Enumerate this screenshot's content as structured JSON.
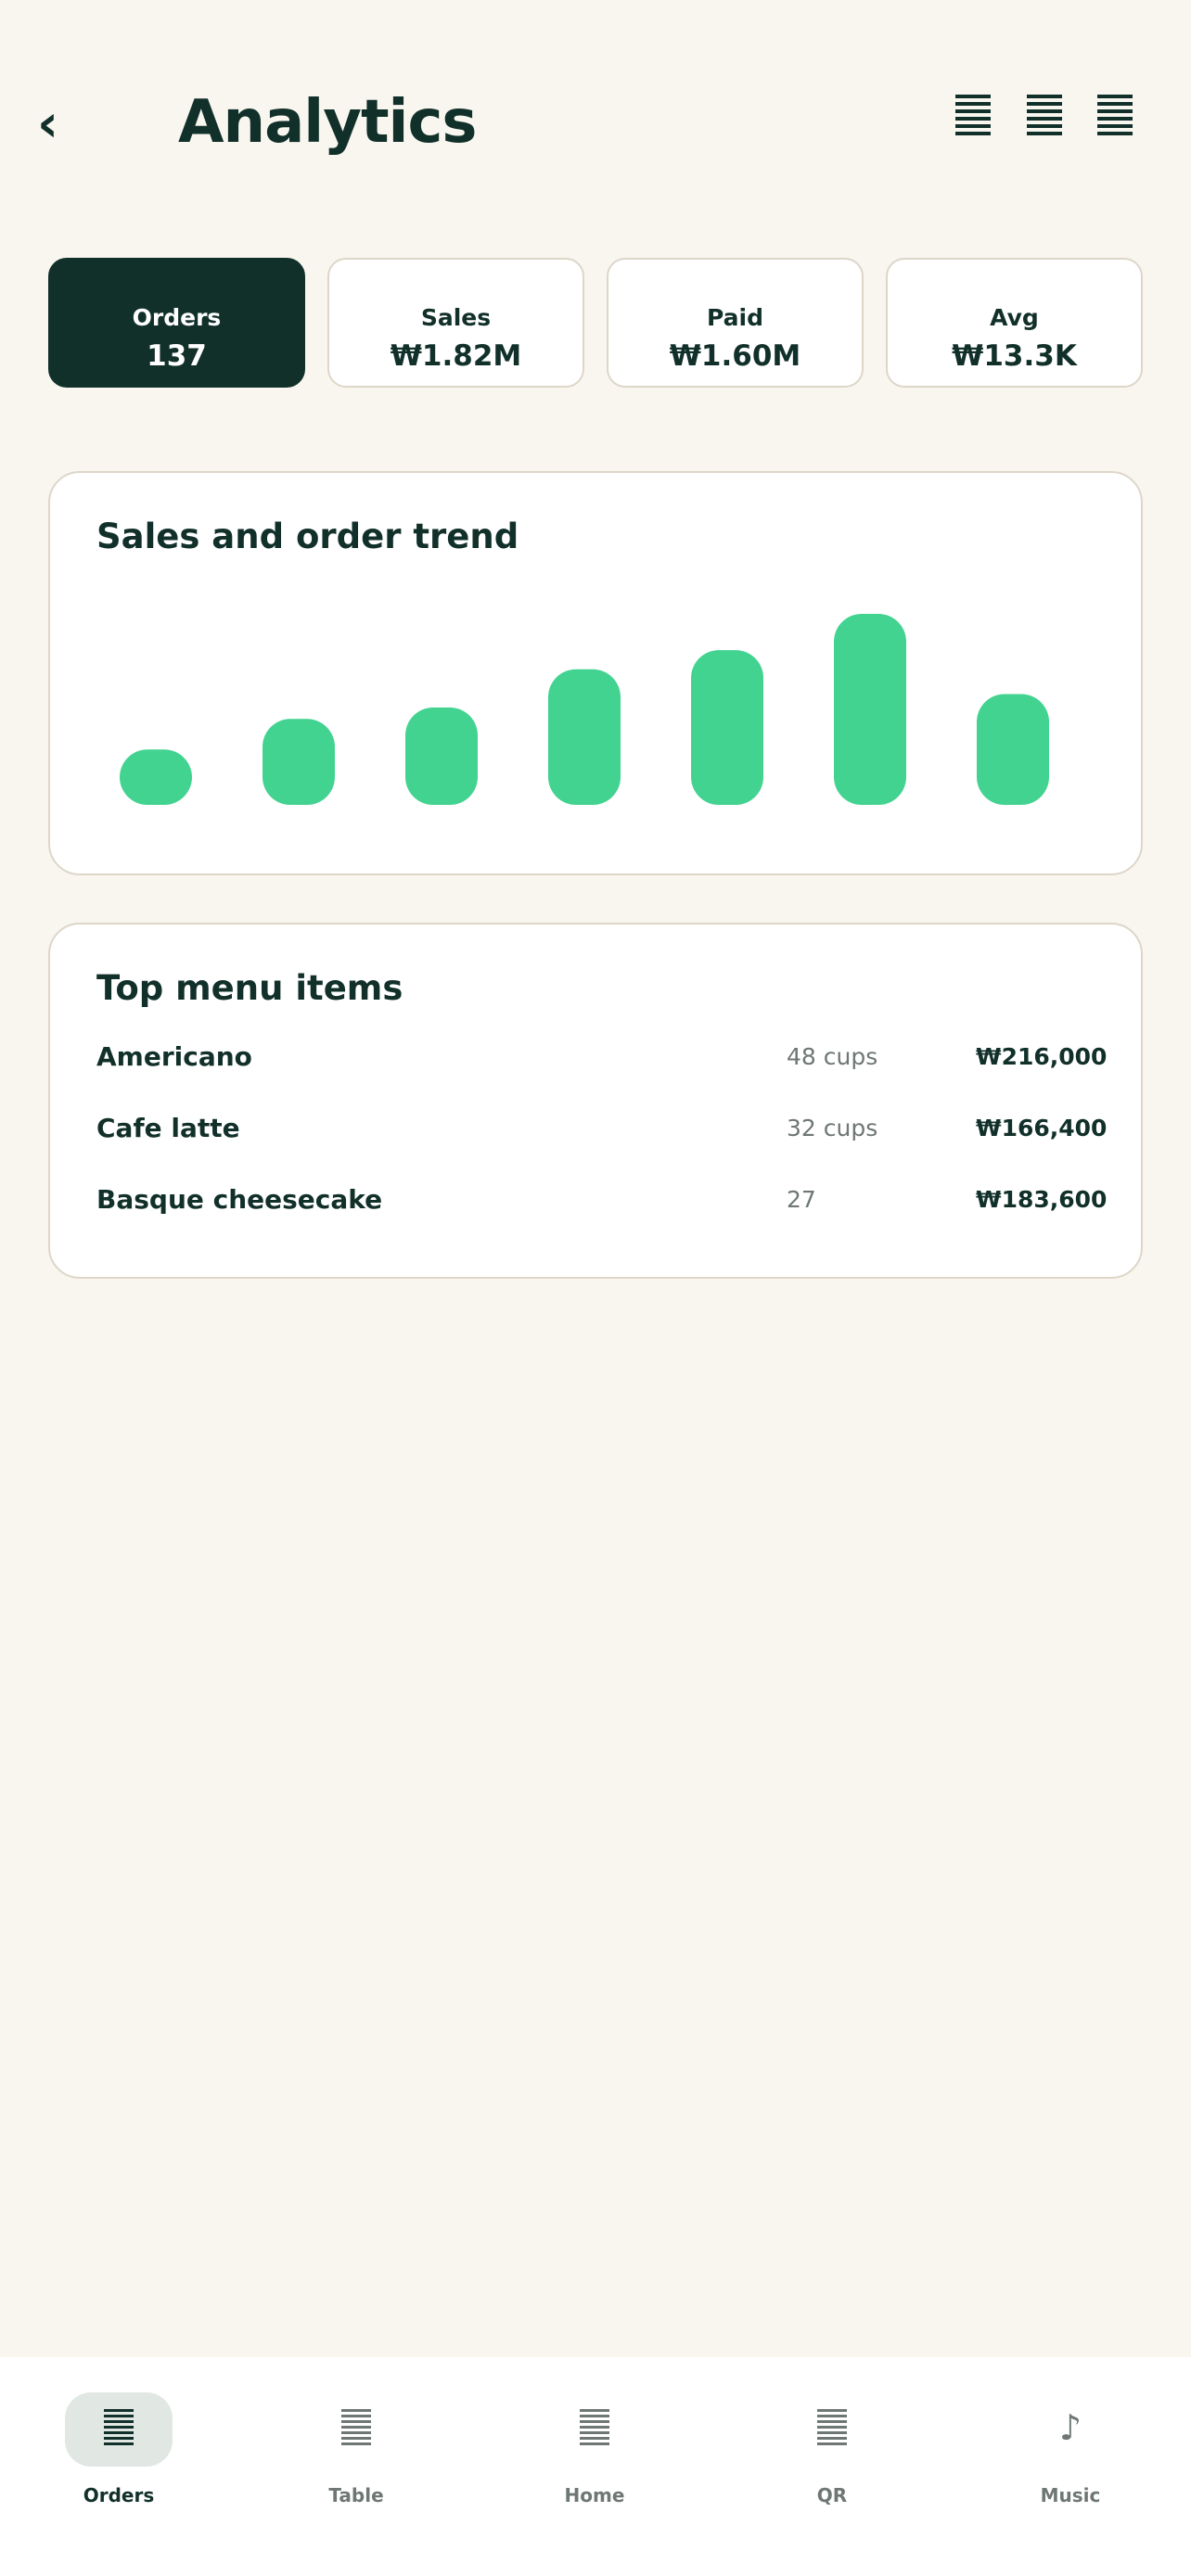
{
  "header": {
    "back_glyph": "‹",
    "title": "Analytics",
    "actions": [
      "list-icon",
      "list-icon",
      "list-icon"
    ]
  },
  "kpis": [
    {
      "label": "Orders",
      "value": "137",
      "active": true
    },
    {
      "label": "Sales",
      "value": "₩1.82M",
      "active": false
    },
    {
      "label": "Paid",
      "value": "₩1.60M",
      "active": false
    },
    {
      "label": "Avg",
      "value": "₩13.3K",
      "active": false
    }
  ],
  "trend": {
    "title": "Sales and order trend"
  },
  "chart_data": {
    "type": "bar",
    "title": "Sales and order trend",
    "categories": [],
    "values": [
      0.29,
      0.45,
      0.51,
      0.71,
      0.81,
      1.0,
      0.58
    ],
    "ylim": [
      0,
      1
    ],
    "grid": false,
    "legend": "none",
    "bar_color": "#43d391"
  },
  "menu": {
    "title": "Top menu items",
    "items": [
      {
        "name": "Americano",
        "qty": "48 cups",
        "amount": "₩216,000"
      },
      {
        "name": "Cafe latte",
        "qty": "32 cups",
        "amount": "₩166,400"
      },
      {
        "name": "Basque cheesecake",
        "qty": "27",
        "amount": "₩183,600"
      }
    ]
  },
  "nav": {
    "items": [
      {
        "label": "Orders",
        "icon": "list-icon",
        "active": true
      },
      {
        "label": "Table",
        "icon": "list-icon",
        "active": false
      },
      {
        "label": "Home",
        "icon": "list-icon",
        "active": false
      },
      {
        "label": "QR",
        "icon": "list-icon",
        "active": false
      },
      {
        "label": "Music",
        "icon": "music-note-icon",
        "glyph": "♪",
        "active": false
      }
    ]
  },
  "colors": {
    "background": "#f9f6f0",
    "primary": "#12302a",
    "accent": "#43d391",
    "muted": "#6e7773",
    "border": "#ddd6c9"
  }
}
